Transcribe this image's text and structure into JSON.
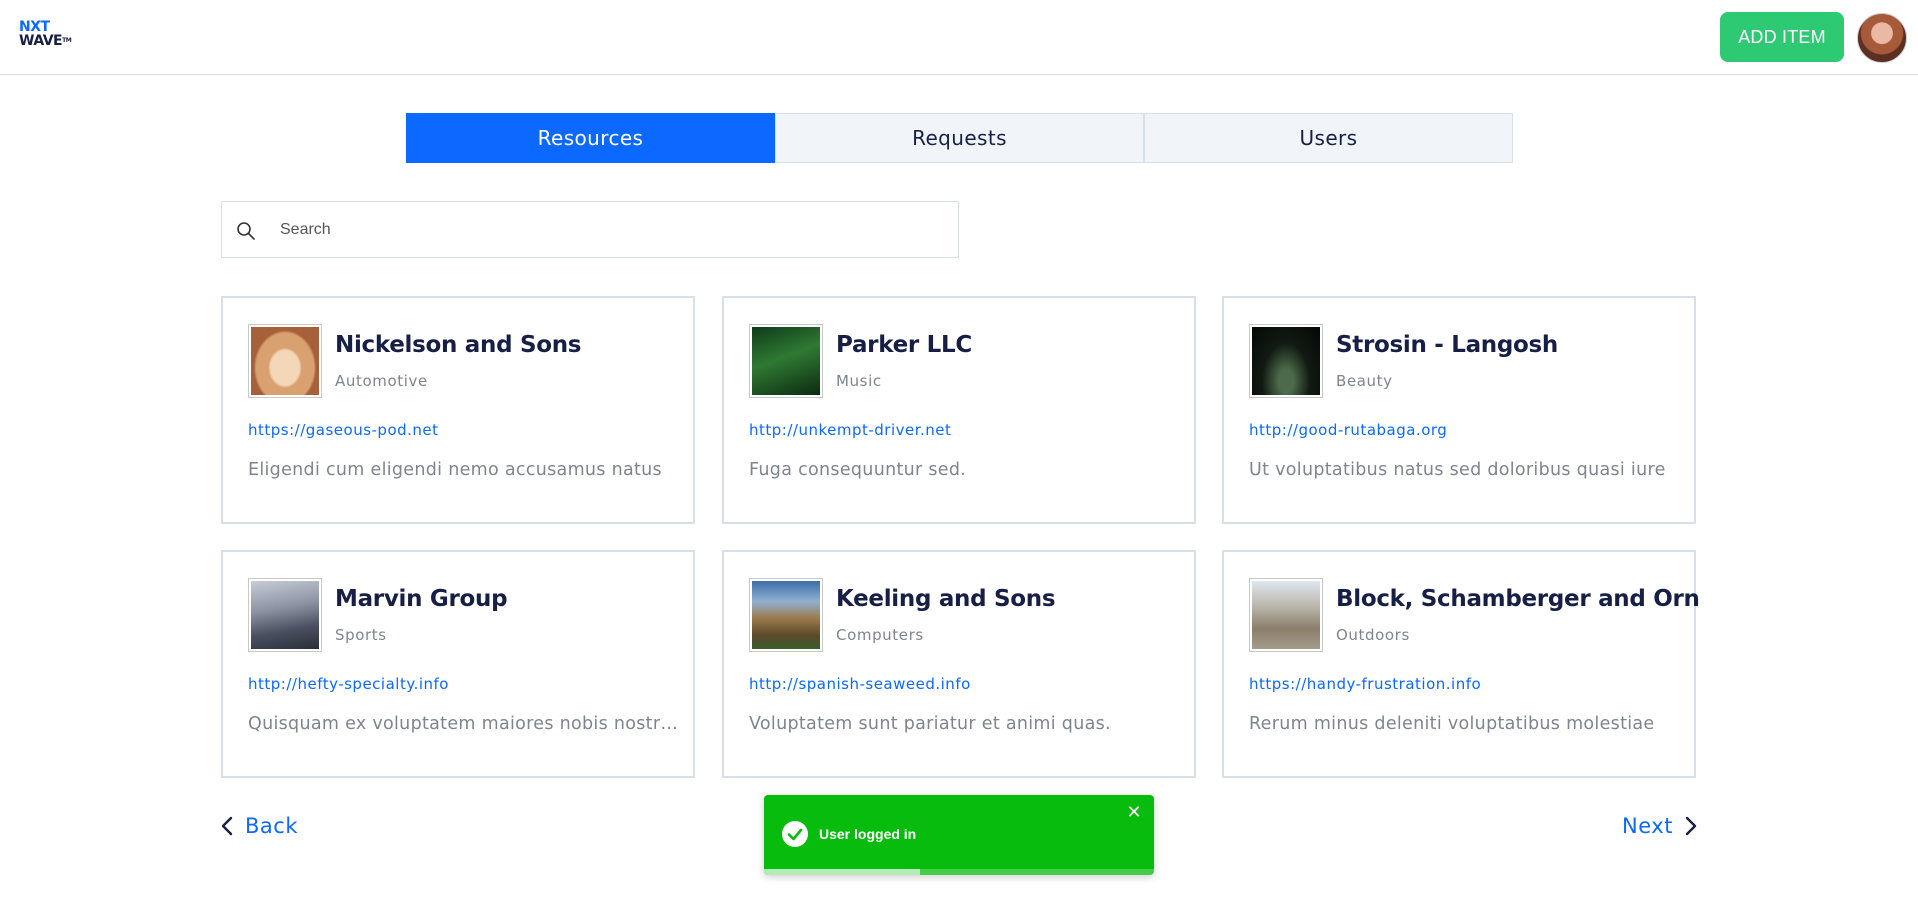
{
  "header": {
    "logo_line1": "NXT",
    "logo_line2": "WAVE",
    "logo_tm": "TM",
    "add_button": "ADD ITEM"
  },
  "tabs": [
    {
      "label": "Resources",
      "active": true
    },
    {
      "label": "Requests",
      "active": false
    },
    {
      "label": "Users",
      "active": false
    }
  ],
  "search": {
    "placeholder": "Search",
    "value": ""
  },
  "cards": [
    {
      "title": "Nickelson and Sons",
      "category": "Automotive",
      "link": "https://gaseous-pod.net",
      "description": "Eligendi cum eligendi nemo accusamus natus"
    },
    {
      "title": "Parker LLC",
      "category": "Music",
      "link": "http://unkempt-driver.net",
      "description": "Fuga consequuntur sed."
    },
    {
      "title": "Strosin - Langosh",
      "category": "Beauty",
      "link": "http://good-rutabaga.org",
      "description": "Ut voluptatibus natus sed doloribus quasi iure"
    },
    {
      "title": "Marvin Group",
      "category": "Sports",
      "link": "http://hefty-specialty.info",
      "description": "Quisquam ex voluptatem maiores nobis nostrum"
    },
    {
      "title": "Keeling and Sons",
      "category": "Computers",
      "link": "http://spanish-seaweed.info",
      "description": "Voluptatem sunt pariatur et animi quas."
    },
    {
      "title": "Block, Schamberger and Orn",
      "category": "Outdoors",
      "link": "https://handy-frustration.info",
      "description": "Rerum minus deleniti voluptatibus molestiae"
    }
  ],
  "pagination": {
    "back": "Back",
    "next": "Next"
  },
  "toast": {
    "message": "User logged in",
    "progress": 0.4
  },
  "colors": {
    "primary": "#0b69ff",
    "add_button": "#2dca73",
    "toast": "#07bc0c"
  }
}
